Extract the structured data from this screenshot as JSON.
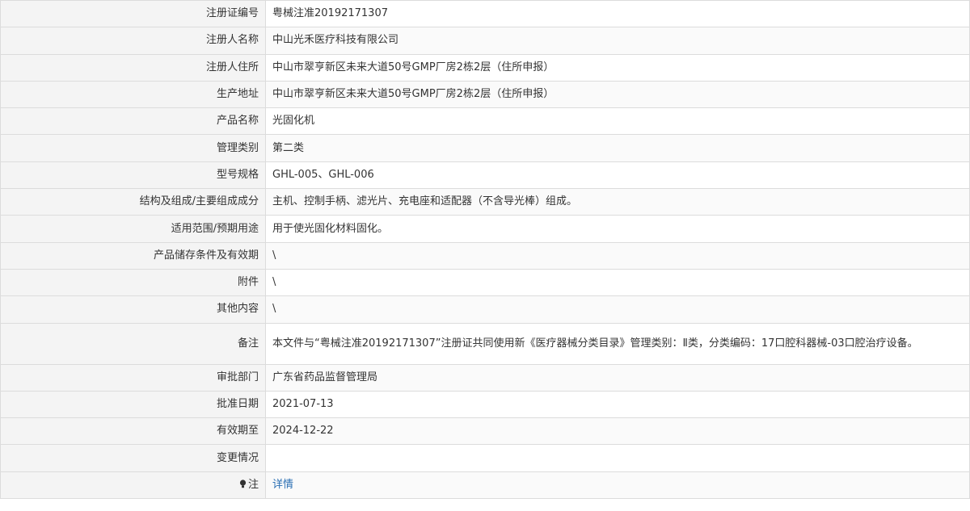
{
  "rows": [
    {
      "label": "注册证编号",
      "value": "粤械注准20192171307"
    },
    {
      "label": "注册人名称",
      "value": "中山光禾医疗科技有限公司"
    },
    {
      "label": "注册人住所",
      "value": "中山市翠亨新区未来大道50号GMP厂房2栋2层（住所申报）"
    },
    {
      "label": "生产地址",
      "value": "中山市翠亨新区未来大道50号GMP厂房2栋2层（住所申报）"
    },
    {
      "label": "产品名称",
      "value": "光固化机"
    },
    {
      "label": "管理类别",
      "value": "第二类"
    },
    {
      "label": "型号规格",
      "value": "GHL-005、GHL-006"
    },
    {
      "label": "结构及组成/主要组成成分",
      "value": "主机、控制手柄、滤光片、充电座和适配器（不含导光棒）组成。"
    },
    {
      "label": "适用范围/预期用途",
      "value": "用于使光固化材料固化。"
    },
    {
      "label": "产品储存条件及有效期",
      "value": "\\"
    },
    {
      "label": "附件",
      "value": "\\"
    },
    {
      "label": "其他内容",
      "value": "\\"
    },
    {
      "label": "备注",
      "value": "本文件与“粤械注准20192171307”注册证共同使用新《医疗器械分类目录》管理类别：Ⅱ类，分类编码：17口腔科器械-03口腔治疗设备。"
    },
    {
      "label": "审批部门",
      "value": "广东省药品监督管理局"
    },
    {
      "label": "批准日期",
      "value": "2021-07-13"
    },
    {
      "label": "有效期至",
      "value": "2024-12-22"
    },
    {
      "label": "变更情况",
      "value": ""
    }
  ],
  "note": {
    "icon": "bulb-icon",
    "label": "注",
    "link_text": "详情",
    "link_color": "#2a6fb3"
  }
}
